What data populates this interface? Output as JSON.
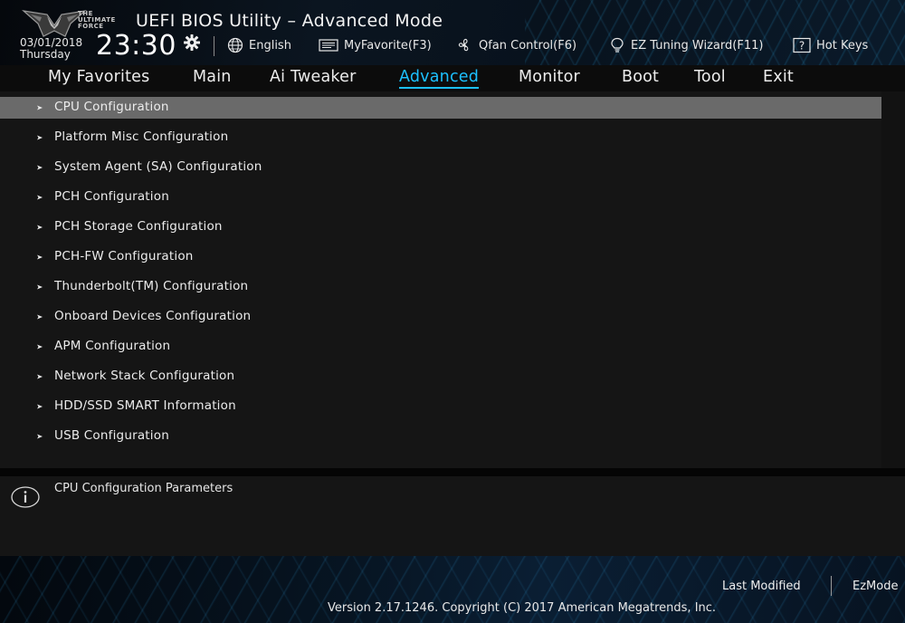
{
  "header": {
    "logo_text": "THE ULTIMATE FORCE",
    "title": "UEFI BIOS Utility – Advanced Mode",
    "date": "03/01/2018",
    "day": "Thursday",
    "time": "23:30",
    "language": "English",
    "my_favorite": "MyFavorite(F3)",
    "qfan": "Qfan Control(F6)",
    "ez_tuning": "EZ Tuning Wizard(F11)",
    "hot_keys": "Hot Keys"
  },
  "tabs": [
    {
      "label": "My Favorites",
      "active": false
    },
    {
      "label": "Main",
      "active": false
    },
    {
      "label": "Ai Tweaker",
      "active": false
    },
    {
      "label": "Advanced",
      "active": true
    },
    {
      "label": "Monitor",
      "active": false
    },
    {
      "label": "Boot",
      "active": false
    },
    {
      "label": "Tool",
      "active": false
    },
    {
      "label": "Exit",
      "active": false
    }
  ],
  "menu": {
    "items": [
      {
        "label": "CPU Configuration",
        "selected": true
      },
      {
        "label": "Platform Misc Configuration",
        "selected": false
      },
      {
        "label": "System Agent (SA) Configuration",
        "selected": false
      },
      {
        "label": "PCH Configuration",
        "selected": false
      },
      {
        "label": "PCH Storage Configuration",
        "selected": false
      },
      {
        "label": "PCH-FW Configuration",
        "selected": false
      },
      {
        "label": "Thunderbolt(TM) Configuration",
        "selected": false
      },
      {
        "label": "Onboard Devices Configuration",
        "selected": false
      },
      {
        "label": "APM Configuration",
        "selected": false
      },
      {
        "label": "Network Stack Configuration",
        "selected": false
      },
      {
        "label": "HDD/SSD SMART Information",
        "selected": false
      },
      {
        "label": "USB Configuration",
        "selected": false
      }
    ]
  },
  "help": {
    "text": "CPU Configuration Parameters"
  },
  "footer": {
    "last_modified": "Last Modified",
    "ez_mode": "EzMode",
    "version": "Version 2.17.1246. Copyright (C) 2017 American Megatrends, Inc."
  },
  "colors": {
    "accent": "#1cc0ff",
    "selected_row": "#6a6a6a",
    "panel": "#151515"
  }
}
